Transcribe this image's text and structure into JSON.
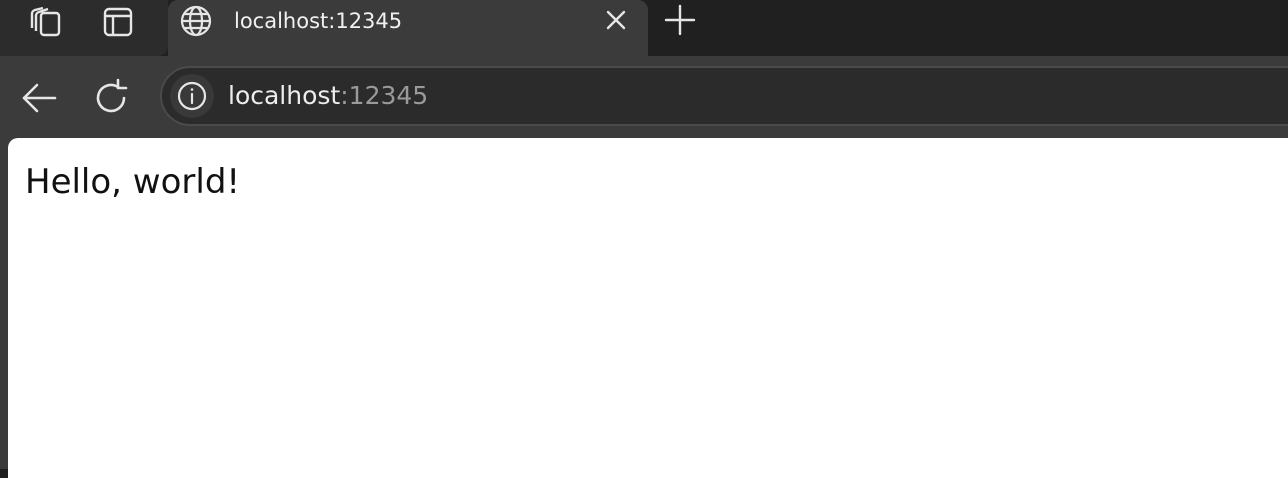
{
  "browser": {
    "tab": {
      "title": "localhost:12345",
      "icon": "globe-icon"
    },
    "tabstrip_icons": [
      "collections-icon",
      "vertical-tabs-icon"
    ],
    "new_tab_icon": "plus-icon",
    "close_tab_icon": "close-icon",
    "toolbar_icons": [
      "back-arrow-icon",
      "refresh-icon"
    ],
    "address_bar": {
      "host": "localhost",
      "port": ":12345",
      "info_icon": "info-icon"
    }
  },
  "page": {
    "text": "Hello, world!"
  },
  "colors": {
    "chrome_dark": "#202020",
    "chrome_toolbar": "#3b3b3b",
    "page_background": "#ffffff"
  }
}
